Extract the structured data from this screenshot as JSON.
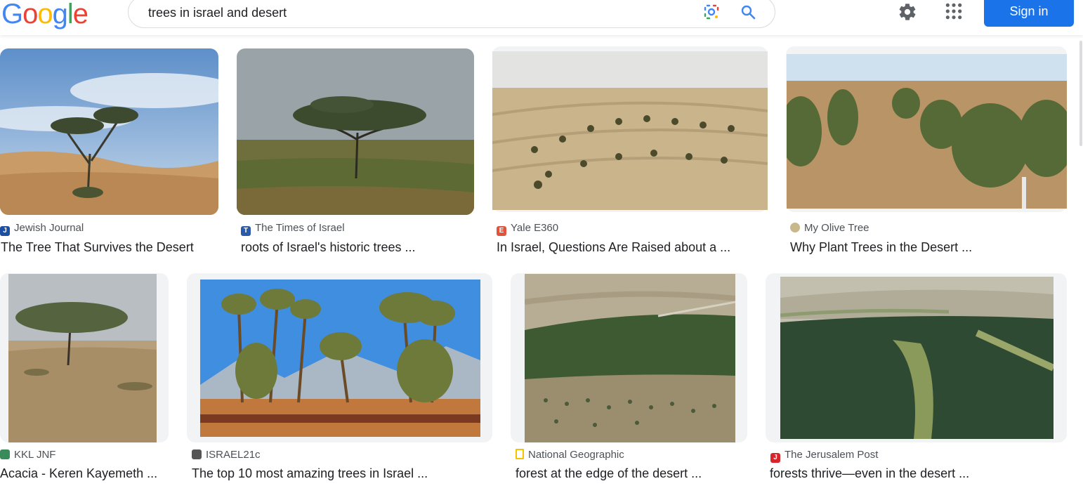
{
  "header": {
    "logo_letters": [
      {
        "ch": "G",
        "color": "#4285f4"
      },
      {
        "ch": "o",
        "color": "#ea4335"
      },
      {
        "ch": "o",
        "color": "#fbbc05"
      },
      {
        "ch": "g",
        "color": "#4285f4"
      },
      {
        "ch": "l",
        "color": "#34a853"
      },
      {
        "ch": "e",
        "color": "#ea4335"
      }
    ],
    "search_value": "trees in israel and desert",
    "lens_icon": "google-lens-icon",
    "search_icon": "search-icon",
    "settings_icon": "gear-icon",
    "apps_icon": "apps-grid-icon",
    "signin_label": "Sign in",
    "accent": "#1a73e8"
  },
  "results": [
    {
      "source": "Jewish Journal",
      "title": "The Tree That Survives the Desert",
      "fav_color": "#1a4fa3",
      "fav_text": "JJ"
    },
    {
      "source": "The Times of Israel",
      "title": "roots of Israel's historic trees ...",
      "fav_color": "#2a5aa8",
      "fav_text": "TOI"
    },
    {
      "source": "Yale E360",
      "title": "In Israel, Questions Are Raised about a ...",
      "fav_color": "#e0533d",
      "fav_text": "E"
    },
    {
      "source": "My Olive Tree",
      "title": "Why Plant Trees in the Desert ...",
      "fav_color": "#c9b88a",
      "fav_text": ""
    },
    {
      "source": "KKL JNF",
      "title": "Acacia - Keren Kayemeth ...",
      "fav_color": "#3a8b5a",
      "fav_text": ""
    },
    {
      "source": "ISRAEL21c",
      "title": "The top 10 most amazing trees in Israel ...",
      "fav_color": "#555555",
      "fav_text": ""
    },
    {
      "source": "National Geographic",
      "title": "forest at the edge of the desert ...",
      "fav_color": "#f5c400",
      "fav_text": ""
    },
    {
      "source": "The Jerusalem Post",
      "title": "forests thrive—even in the desert ...",
      "fav_color": "#d6262b",
      "fav_text": "JP"
    }
  ]
}
